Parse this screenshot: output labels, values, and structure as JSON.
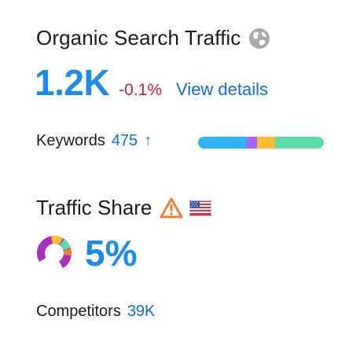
{
  "organic": {
    "title": "Organic Search Traffic",
    "value": "1.2K",
    "delta": "-0.1%",
    "view_details_label": "View details",
    "globe_icon": "globe-icon"
  },
  "keywords": {
    "label": "Keywords",
    "value": "475",
    "trend_icon": "arrow-up-icon",
    "trend_glyph": "↑",
    "distribution": [
      {
        "color": "#2eb3f2",
        "fraction": 0.39
      },
      {
        "color": "#a464ff",
        "fraction": 0.08
      },
      {
        "color": "#ffbb33",
        "fraction": 0.14
      },
      {
        "color": "#5bdba8",
        "fraction": 0.39
      }
    ]
  },
  "traffic_share": {
    "title": "Traffic Share",
    "value": "5%",
    "warning_icon": "warning-icon",
    "flag_icon": "us-flag-icon",
    "donut_icon": "donut-chart-icon"
  },
  "competitors": {
    "label": "Competitors",
    "value": "39K"
  },
  "colors": {
    "accent": "#1c8ceb",
    "link": "#0b6fce",
    "negative": "#d1193e",
    "positive": "#108a5c",
    "warning": "#f07e35"
  }
}
